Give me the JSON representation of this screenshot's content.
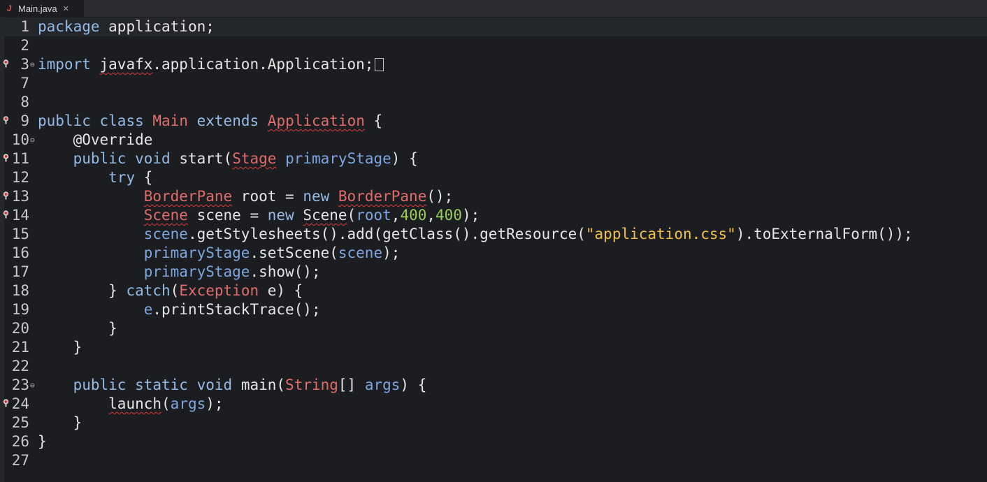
{
  "tab": {
    "filename": "Main.java",
    "icon": "java-file-icon",
    "close_glyph": "✕"
  },
  "colors": {
    "background": "#1b1d20",
    "keyword": "#94bbe6",
    "type": "#e06c6c",
    "variable": "#7ea6e0",
    "number": "#9acd5a",
    "string": "#f0c14b",
    "error_underline": "#e03a3a"
  },
  "lines": [
    {
      "n": "1",
      "current": true,
      "tokens": [
        [
          "kw",
          "package"
        ],
        [
          "plain",
          " application;"
        ]
      ]
    },
    {
      "n": "2",
      "tokens": []
    },
    {
      "n": "3",
      "marker": true,
      "fold": true,
      "tokens": [
        [
          "kw",
          "import"
        ],
        [
          "plain",
          " "
        ],
        [
          "plain-err",
          "javafx"
        ],
        [
          "plain",
          ".application.Application;"
        ],
        [
          "box",
          ""
        ]
      ]
    },
    {
      "n": "7",
      "tokens": []
    },
    {
      "n": "8",
      "tokens": []
    },
    {
      "n": "9",
      "marker": true,
      "tokens": [
        [
          "kw",
          "public"
        ],
        [
          "plain",
          " "
        ],
        [
          "kw",
          "class"
        ],
        [
          "plain",
          " "
        ],
        [
          "type",
          "Main"
        ],
        [
          "plain",
          " "
        ],
        [
          "kw",
          "extends"
        ],
        [
          "plain",
          " "
        ],
        [
          "type-err",
          "Application"
        ],
        [
          "plain",
          " {"
        ]
      ]
    },
    {
      "n": "10",
      "fold": true,
      "tokens": [
        [
          "plain",
          "    @Override"
        ]
      ]
    },
    {
      "n": "11",
      "marker": true,
      "tokens": [
        [
          "plain",
          "    "
        ],
        [
          "kw",
          "public"
        ],
        [
          "plain",
          " "
        ],
        [
          "kw",
          "void"
        ],
        [
          "plain",
          " start("
        ],
        [
          "type-err",
          "Stage"
        ],
        [
          "plain",
          " "
        ],
        [
          "var",
          "primaryStage"
        ],
        [
          "plain",
          ") {"
        ]
      ]
    },
    {
      "n": "12",
      "tokens": [
        [
          "plain",
          "        "
        ],
        [
          "kw",
          "try"
        ],
        [
          "plain",
          " {"
        ]
      ]
    },
    {
      "n": "13",
      "marker": true,
      "tokens": [
        [
          "plain",
          "            "
        ],
        [
          "type-err",
          "BorderPane"
        ],
        [
          "plain",
          " root = "
        ],
        [
          "kw",
          "new"
        ],
        [
          "plain",
          " "
        ],
        [
          "type-err",
          "BorderPane"
        ],
        [
          "plain",
          "();"
        ]
      ]
    },
    {
      "n": "14",
      "marker": true,
      "tokens": [
        [
          "plain",
          "            "
        ],
        [
          "type-err",
          "Scene"
        ],
        [
          "plain",
          " scene = "
        ],
        [
          "kw",
          "new"
        ],
        [
          "plain",
          " "
        ],
        [
          "plain-err",
          "Scene"
        ],
        [
          "plain",
          "("
        ],
        [
          "var",
          "root"
        ],
        [
          "plain",
          ","
        ],
        [
          "num",
          "400"
        ],
        [
          "plain",
          ","
        ],
        [
          "num",
          "400"
        ],
        [
          "plain",
          ");"
        ]
      ]
    },
    {
      "n": "15",
      "tokens": [
        [
          "plain",
          "            "
        ],
        [
          "var",
          "scene"
        ],
        [
          "plain",
          ".getStylesheets().add(getClass().getResource("
        ],
        [
          "str",
          "\"application.css\""
        ],
        [
          "plain",
          ").toExternalForm());"
        ]
      ]
    },
    {
      "n": "16",
      "tokens": [
        [
          "plain",
          "            "
        ],
        [
          "var",
          "primaryStage"
        ],
        [
          "plain",
          ".setScene("
        ],
        [
          "var",
          "scene"
        ],
        [
          "plain",
          ");"
        ]
      ]
    },
    {
      "n": "17",
      "tokens": [
        [
          "plain",
          "            "
        ],
        [
          "var",
          "primaryStage"
        ],
        [
          "plain",
          ".show();"
        ]
      ]
    },
    {
      "n": "18",
      "tokens": [
        [
          "plain",
          "        } "
        ],
        [
          "kw",
          "catch"
        ],
        [
          "plain",
          "("
        ],
        [
          "type",
          "Exception"
        ],
        [
          "plain",
          " e) {"
        ]
      ]
    },
    {
      "n": "19",
      "tokens": [
        [
          "plain",
          "            "
        ],
        [
          "var",
          "e"
        ],
        [
          "plain",
          ".printStackTrace();"
        ]
      ]
    },
    {
      "n": "20",
      "tokens": [
        [
          "plain",
          "        }"
        ]
      ]
    },
    {
      "n": "21",
      "tokens": [
        [
          "plain",
          "    }"
        ]
      ]
    },
    {
      "n": "22",
      "tokens": []
    },
    {
      "n": "23",
      "fold": true,
      "tokens": [
        [
          "plain",
          "    "
        ],
        [
          "kw",
          "public"
        ],
        [
          "plain",
          " "
        ],
        [
          "kw",
          "static"
        ],
        [
          "plain",
          " "
        ],
        [
          "kw",
          "void"
        ],
        [
          "plain",
          " main("
        ],
        [
          "type",
          "String"
        ],
        [
          "plain",
          "[] "
        ],
        [
          "var",
          "args"
        ],
        [
          "plain",
          ") {"
        ]
      ]
    },
    {
      "n": "24",
      "marker": true,
      "tokens": [
        [
          "plain",
          "        "
        ],
        [
          "plain-err",
          "launch"
        ],
        [
          "plain",
          "("
        ],
        [
          "var",
          "args"
        ],
        [
          "plain",
          ");"
        ]
      ]
    },
    {
      "n": "25",
      "tokens": [
        [
          "plain",
          "    }"
        ]
      ]
    },
    {
      "n": "26",
      "tokens": [
        [
          "plain",
          "}"
        ]
      ]
    },
    {
      "n": "27",
      "tokens": []
    }
  ]
}
